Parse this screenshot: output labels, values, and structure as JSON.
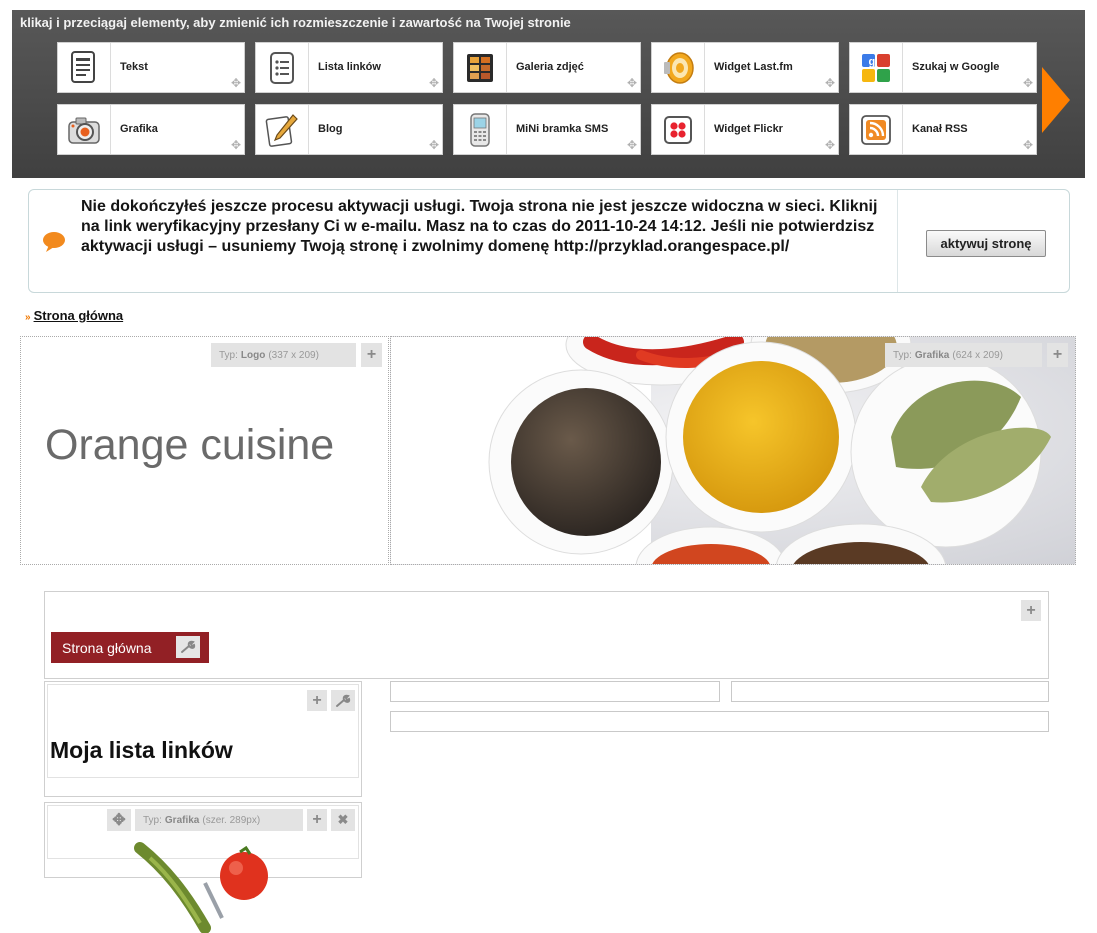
{
  "toolbar": {
    "title": "klikaj i przeciągaj elementy, aby zmienić ich rozmieszczenie i zawartość na Twojej stronie",
    "accent": "#ff7f00",
    "widgets": [
      {
        "label": "Tekst",
        "icon": "text-document-icon"
      },
      {
        "label": "Lista linków",
        "icon": "link-list-icon"
      },
      {
        "label": "Galeria zdjęć",
        "icon": "photo-gallery-icon"
      },
      {
        "label": "Widget Last.fm",
        "icon": "speaker-icon"
      },
      {
        "label": "Szukaj w Google",
        "icon": "google-icon"
      },
      {
        "label": "Grafika",
        "icon": "camera-icon"
      },
      {
        "label": "Blog",
        "icon": "pencil-paper-icon"
      },
      {
        "label": "MiNi bramka SMS",
        "icon": "phone-icon"
      },
      {
        "label": "Widget Flickr",
        "icon": "flickr-icon"
      },
      {
        "label": "Kanał RSS",
        "icon": "rss-icon"
      }
    ]
  },
  "notice": {
    "message": "Nie dokończyłeś jeszcze procesu aktywacji usługi. Twoja strona nie jest jeszcze widoczna w sieci. Kliknij na link weryfikacyjny przesłany Ci w e-mailu. Masz na to czas do 2011-10-24 14:12. Jeśli nie potwierdzisz aktywacji usługi – usuniemy Twoją stronę i zwolnimy domenę http://przyklad.orangespace.pl/",
    "button": "aktywuj stronę"
  },
  "breadcrumb": {
    "label": "Strona główna"
  },
  "header": {
    "logo_tag_prefix": "Typ:",
    "logo_tag_type": "Logo",
    "logo_tag_size": "(337 x 209)",
    "logo_text": "Orange cuisine",
    "image_tag_prefix": "Typ:",
    "image_tag_type": "Grafika",
    "image_tag_size": "(624 x 209)"
  },
  "menu": {
    "item": "Strona główna",
    "color": "#922025"
  },
  "sidebar": {
    "links_title": "Moja lista linków",
    "graphic_tag_prefix": "Typ:",
    "graphic_tag_type": "Grafika",
    "graphic_tag_size": "(szer. 289px)"
  }
}
